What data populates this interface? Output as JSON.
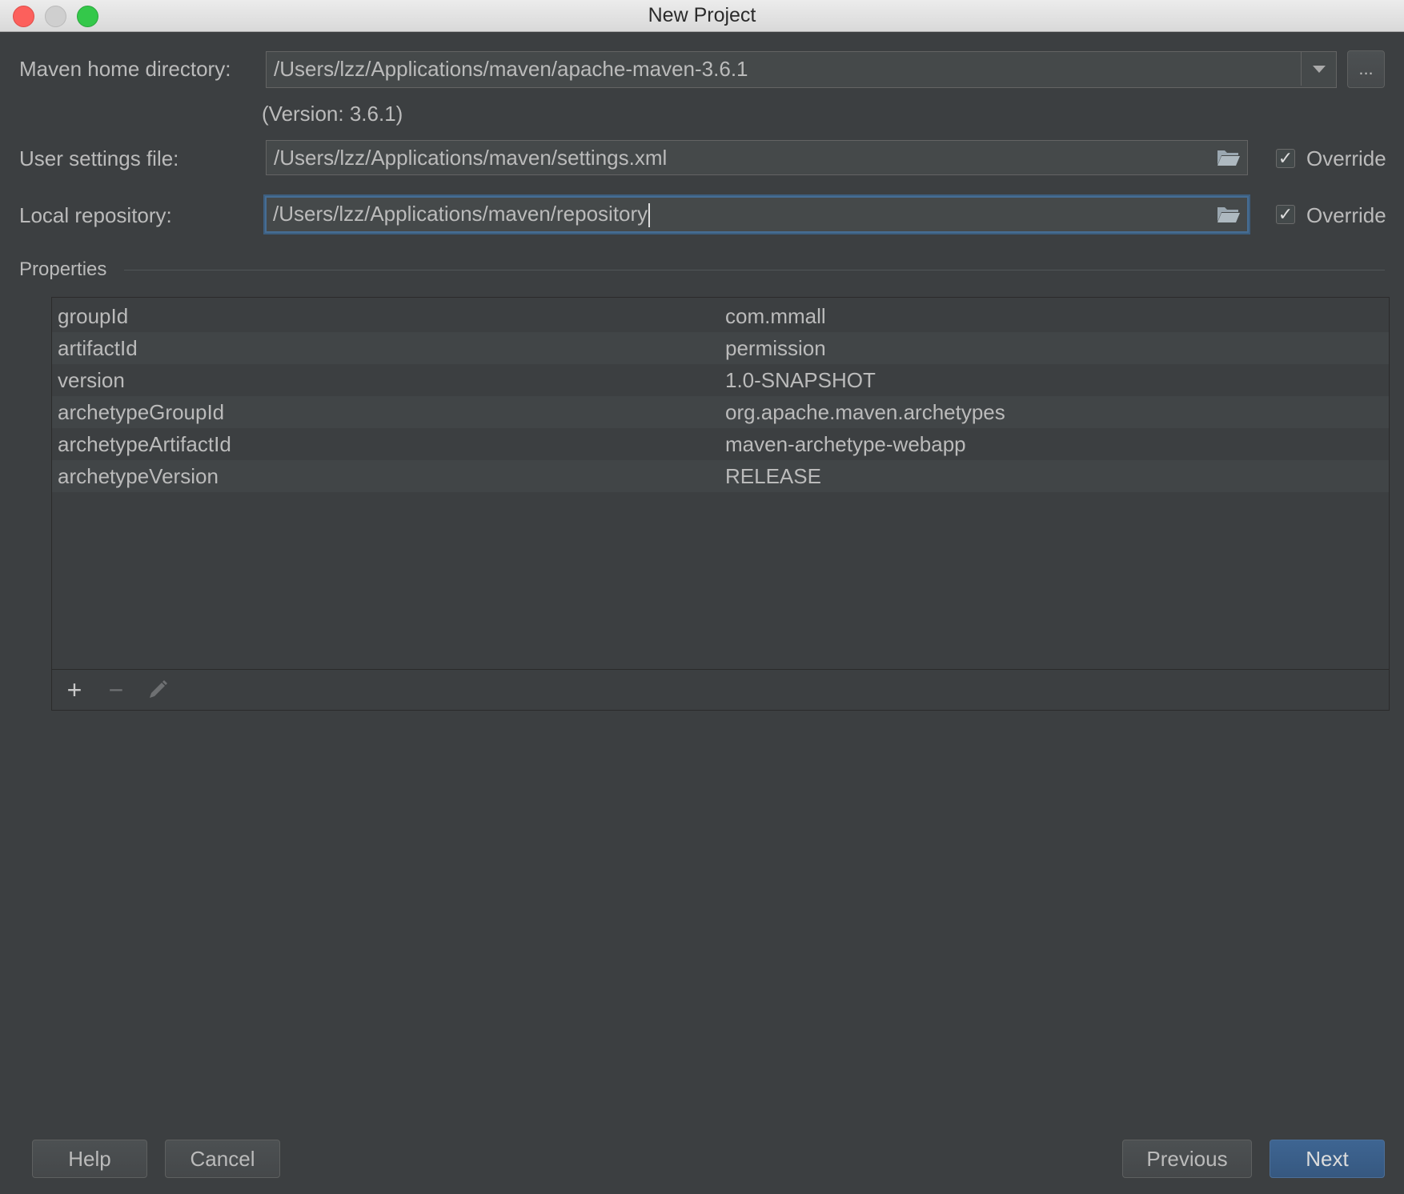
{
  "window": {
    "title": "New Project"
  },
  "maven_home": {
    "label": "Maven home directory:",
    "value": "/Users/lzz/Applications/maven/apache-maven-3.6.1",
    "version": "(Version: 3.6.1)",
    "browse_label": "..."
  },
  "user_settings": {
    "label": "User settings file:",
    "value": "/Users/lzz/Applications/maven/settings.xml",
    "override_label": "Override",
    "override_checked": true
  },
  "local_repo": {
    "label": "Local repository:",
    "value": "/Users/lzz/Applications/maven/repository",
    "override_label": "Override",
    "override_checked": true
  },
  "properties": {
    "title": "Properties",
    "rows": [
      {
        "key": "groupId",
        "value": "com.mmall"
      },
      {
        "key": "artifactId",
        "value": "permission"
      },
      {
        "key": "version",
        "value": "1.0-SNAPSHOT"
      },
      {
        "key": "archetypeGroupId",
        "value": "org.apache.maven.archetypes"
      },
      {
        "key": "archetypeArtifactId",
        "value": "maven-archetype-webapp"
      },
      {
        "key": "archetypeVersion",
        "value": "RELEASE"
      }
    ],
    "toolbar": {
      "add_icon": "plus-icon",
      "remove_icon": "minus-icon",
      "edit_icon": "pencil-icon"
    }
  },
  "buttons": {
    "help": "Help",
    "cancel": "Cancel",
    "previous": "Previous",
    "next": "Next"
  },
  "colors": {
    "background": "#3c3f41",
    "accent": "#365880",
    "text": "#bbbbbb"
  }
}
